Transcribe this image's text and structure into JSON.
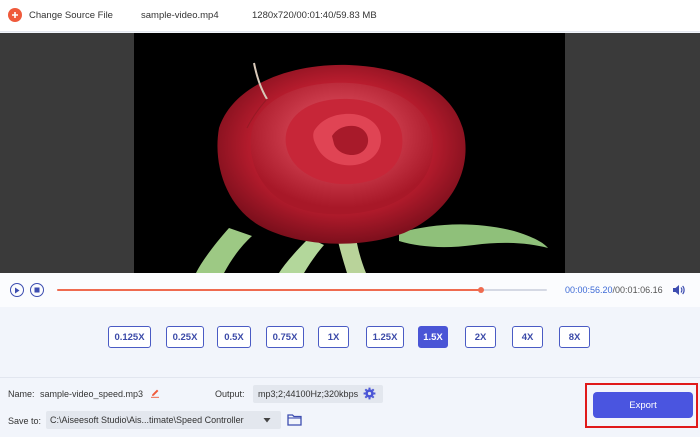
{
  "topbar": {
    "change_source_label": "Change Source File",
    "file_name": "sample-video.mp4",
    "file_meta": "1280x720/00:01:40/59.83 MB"
  },
  "player": {
    "current_time": "00:00:56.20",
    "total_time": "/00:01:06.16",
    "progress": 0.865
  },
  "speeds": {
    "options": [
      "0.125X",
      "0.25X",
      "0.5X",
      "0.75X",
      "1X",
      "1.25X",
      "1.5X",
      "2X",
      "4X",
      "8X"
    ],
    "selected": "1.5X"
  },
  "settings": {
    "name_label": "Name:",
    "name_value": "sample-video_speed.mp3",
    "output_label": "Output:",
    "output_value": "mp3;2;44100Hz;320kbps",
    "save_to_label": "Save to:",
    "save_to_path": "C:\\Aiseesoft Studio\\Ais...timate\\Speed Controller"
  },
  "actions": {
    "export_label": "Export"
  },
  "colors": {
    "accent": "#4a55e0",
    "progress": "#ef6b4f",
    "highlight": "#e01a1a"
  }
}
